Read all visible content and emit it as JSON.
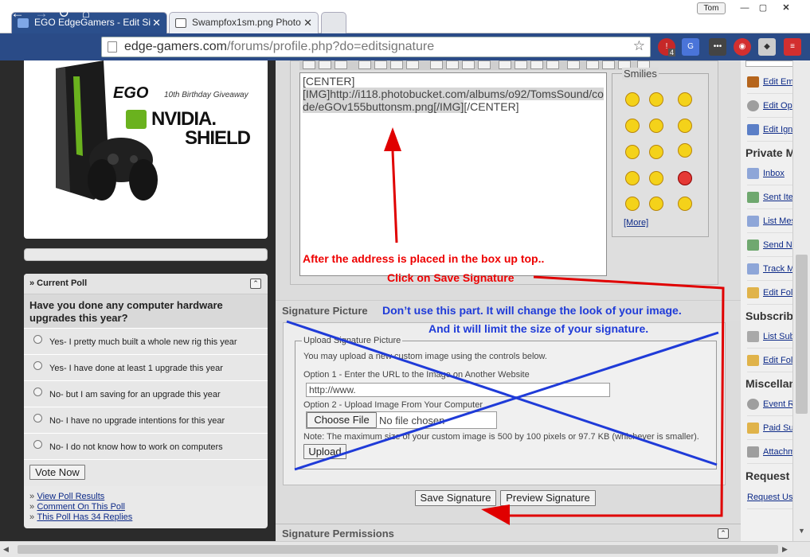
{
  "browser": {
    "tabs": [
      {
        "label": "EGO EdgeGamers - Edit Si"
      },
      {
        "label": "Swampfox1sm.png Photo"
      }
    ],
    "user_label": "Tom",
    "url_host": "edge-gamers.com",
    "url_path": "/forums/profile.php?do=editsignature",
    "extension_badge": "4"
  },
  "promo": {
    "brand": "EGO",
    "tagline": "10th Birthday Giveaway",
    "product_line1": "NVIDIA.",
    "product_line2": "SHIELD"
  },
  "poll": {
    "heading": "» Current Poll",
    "question": "Have you done any computer hardware upgrades this year?",
    "options": [
      "Yes- I pretty much built a whole new rig this year",
      "Yes- I have done at least 1 upgrade this year",
      "No- but I am saving for an upgrade this year",
      "No- I have no upgrade intentions for this year",
      "No- I do not know how to work on computers"
    ],
    "vote_label": "Vote Now",
    "links": [
      "View Poll Results",
      "Comment On This Poll",
      "This Poll Has 34 Replies"
    ],
    "link_prefix": "»"
  },
  "editor": {
    "line1": "[CENTER]",
    "line2_hl": "[IMG]http://i118.photobucket.com/albums/o92/TomsSound/code/eGOv155buttonsm.png[/IMG]",
    "line2_tail": "[/CENTER]"
  },
  "smilies": {
    "legend": "Smilies",
    "more": "[More]"
  },
  "signature_picture": {
    "heading": "Signature Picture",
    "legend": "Upload Signature Picture",
    "intro": "You may upload a new custom image using the controls below.",
    "option1": "Option 1 - Enter the URL to the Image on Another Website",
    "url_value": "http://www.",
    "option2": "Option 2 - Upload Image From Your Computer",
    "choose_file": "Choose File",
    "no_file": "No file chosen",
    "note": "Note: The maximum size of your custom image is 500 by 100 pixels or 97.7 KB (whichever is smaller).",
    "upload": "Upload"
  },
  "actions": {
    "save": "Save Signature",
    "preview": "Preview Signature"
  },
  "permissions": {
    "heading": "Signature Permissions"
  },
  "annotations": {
    "red1": "After the address is placed in the box up top..",
    "red2": "Click on Save Signature",
    "blue1": "Don’t use this part. It will change the look of your image.",
    "blue2": "And it will limit the size of your signature.",
    "red_color": "#e00000",
    "blue_color": "#1f3bd8"
  },
  "right_column": {
    "top_links": [
      "Edit Em",
      "Edit Op",
      "Edit Ign"
    ],
    "private_heading": "Private M",
    "private_links": [
      "Inbox",
      "Sent Ite",
      "List Mes",
      "Send N",
      "Track M",
      "Edit Fol"
    ],
    "subscribe_heading": "Subscribe",
    "subscribe_links": [
      "List Sub",
      "Edit Fol"
    ],
    "misc_heading": "Miscellan",
    "misc_links": [
      "Event R",
      "Paid Su",
      "Attachm"
    ],
    "request_heading": "Request U",
    "request_links": [
      "Request Us"
    ]
  }
}
